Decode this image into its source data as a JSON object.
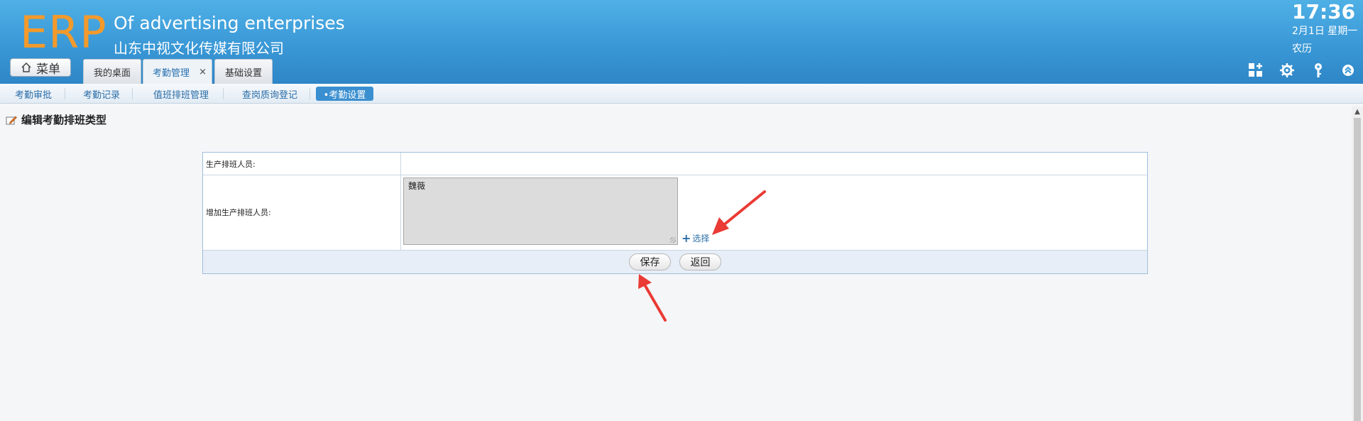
{
  "header": {
    "logo": "ERP",
    "company_en": "Of advertising enterprises",
    "company_cn": "山东中视文化传媒有限公司",
    "time": "17:36",
    "date": "2月1日 星期一",
    "lunar": "农历",
    "menu_label": "菜单",
    "tabs": [
      {
        "label": "我的桌面",
        "active": false,
        "closable": false
      },
      {
        "label": "考勤管理",
        "active": true,
        "closable": true,
        "close_glyph": "×"
      },
      {
        "label": "基础设置",
        "active": false,
        "closable": false
      }
    ],
    "icons": [
      "apps-add-icon",
      "gear-icon",
      "key-icon",
      "collapse-up-icon"
    ]
  },
  "subnav": {
    "items": [
      {
        "label": "考勤审批",
        "active": false
      },
      {
        "label": "考勤记录",
        "active": false
      },
      {
        "label": "值班排班管理",
        "active": false
      },
      {
        "label": "查岗质询登记",
        "active": false
      },
      {
        "label": "•考勤设置",
        "active": true
      }
    ]
  },
  "page": {
    "title": "编辑考勤排班类型",
    "title_icon": "edit-icon"
  },
  "form": {
    "row1_label": "生产排班人员:",
    "row2_label": "增加生产排班人员:",
    "textarea_value": "魏薇",
    "select_label": "选择",
    "save_label": "保存",
    "back_label": "返回"
  },
  "colors": {
    "header_top": "#4fb0e6",
    "header_bottom": "#2e86c7",
    "logo": "#f39a2c",
    "link": "#2a6ea8",
    "arrow": "#ea3b35"
  }
}
